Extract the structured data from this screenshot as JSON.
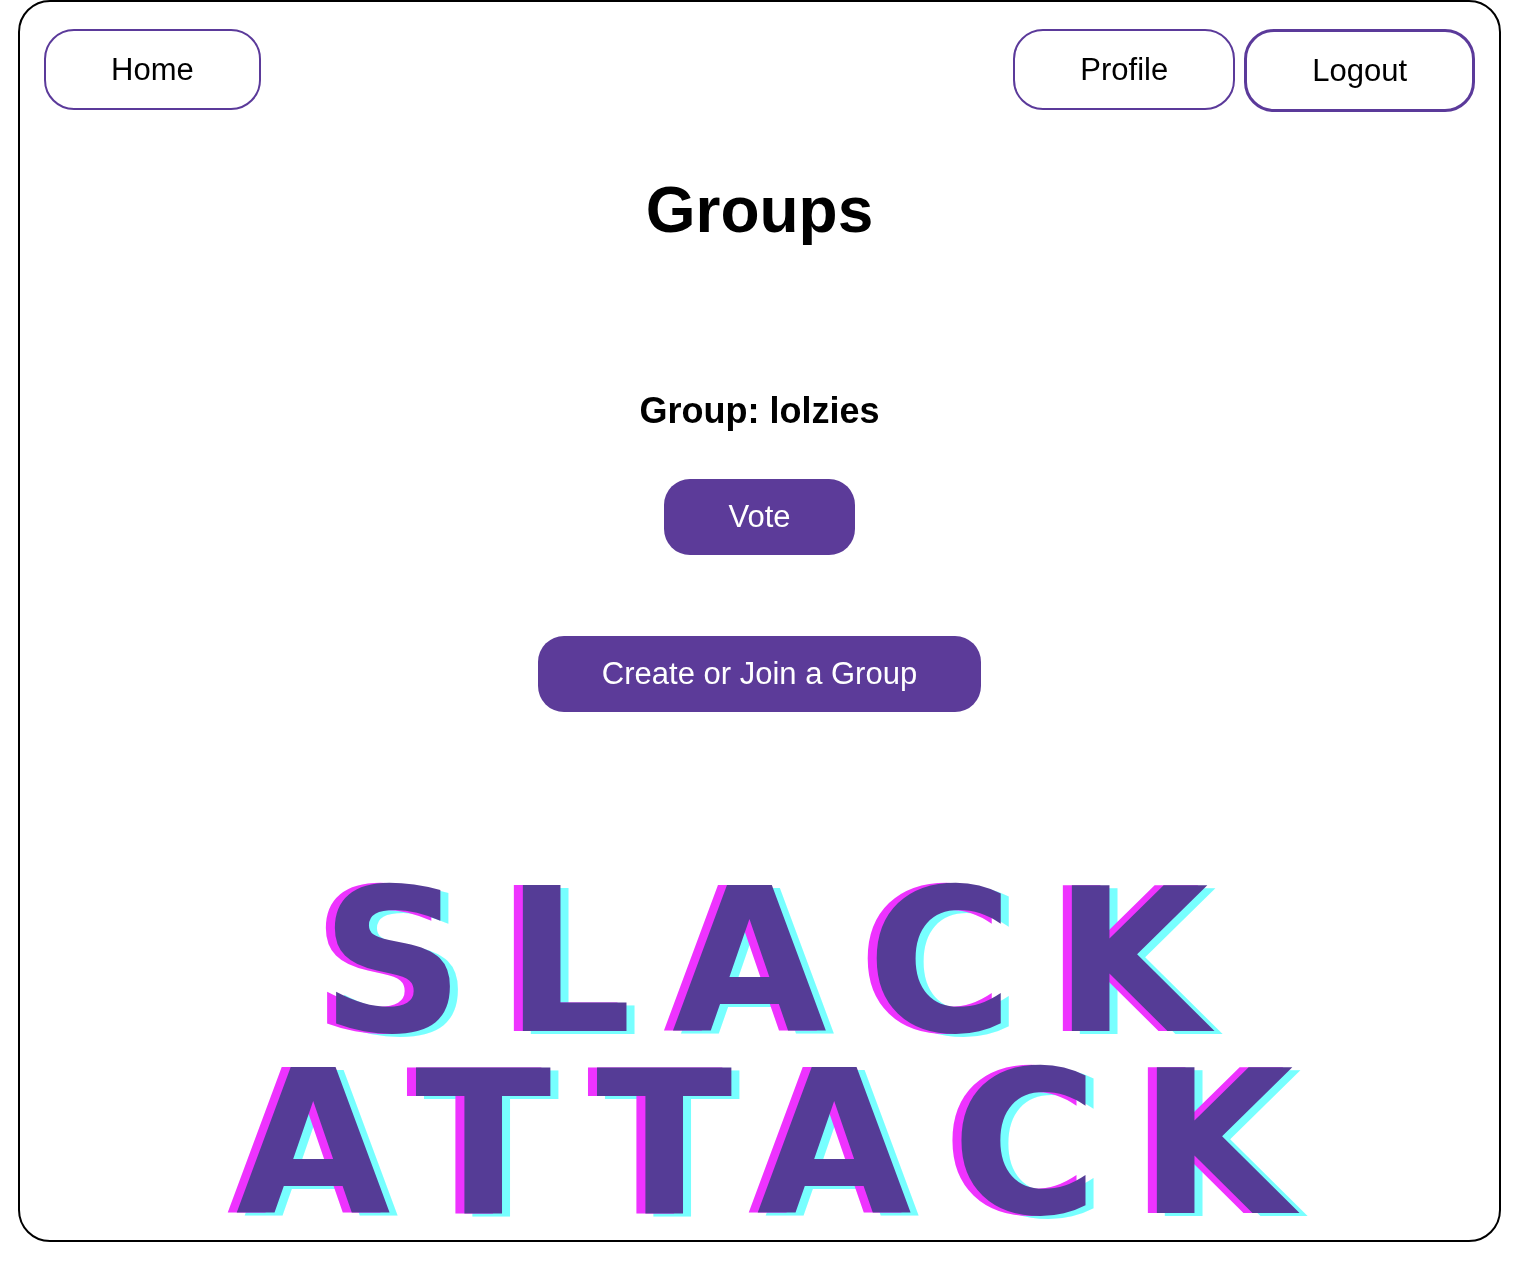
{
  "nav": {
    "left": [
      {
        "label": "Home",
        "focused": false
      }
    ],
    "right": [
      {
        "label": "Profile",
        "focused": false
      },
      {
        "label": "Logout",
        "focused": true
      }
    ]
  },
  "page_title": "Groups",
  "group": {
    "heading": "Group: lolzies",
    "actions": [
      {
        "label": "Vote"
      }
    ]
  },
  "create_button": {
    "label": "Create or Join a Group"
  },
  "logo": {
    "lines": [
      "SLACK",
      "ATTACK"
    ]
  }
}
